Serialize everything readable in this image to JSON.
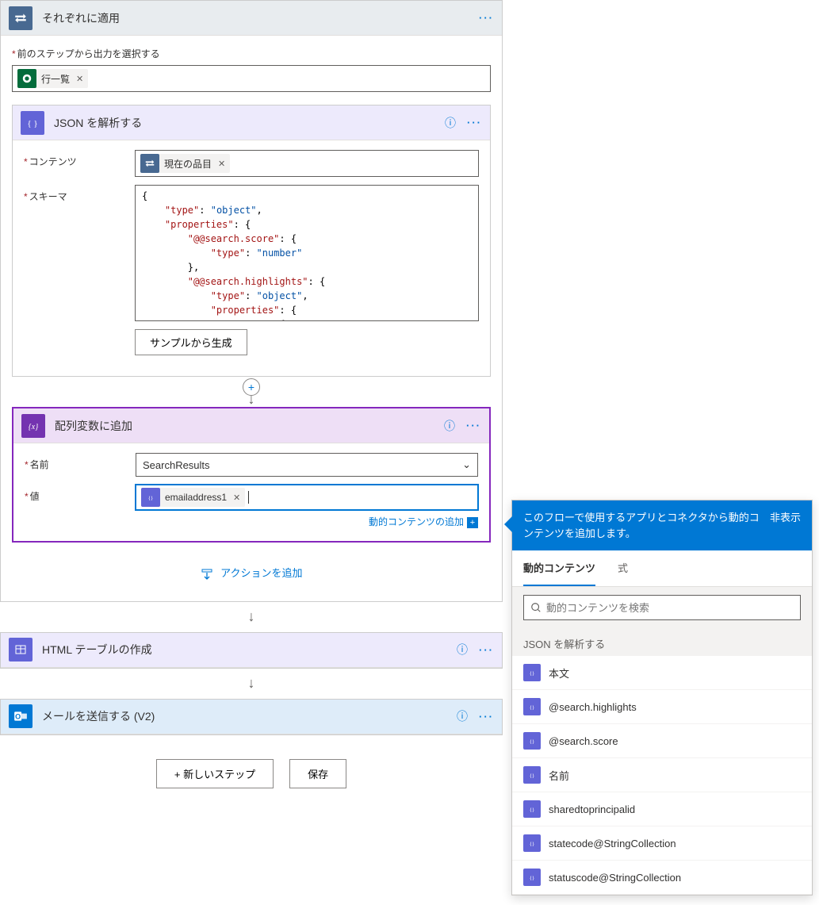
{
  "foreach": {
    "title": "それぞれに適用",
    "select_output_label": "前のステップから出力を選択する",
    "token_label": "行一覧"
  },
  "parseJson": {
    "title": "JSON を解析する",
    "content_label": "コンテンツ",
    "content_token": "現在の品目",
    "schema_label": "スキーマ",
    "sample_button": "サンプルから生成",
    "schema_lines": [
      [
        {
          "t": "p",
          "v": "{"
        }
      ],
      [
        {
          "t": "p",
          "v": "    "
        },
        {
          "t": "k",
          "v": "\"type\""
        },
        {
          "t": "p",
          "v": ": "
        },
        {
          "t": "v",
          "v": "\"object\""
        },
        {
          "t": "p",
          "v": ","
        }
      ],
      [
        {
          "t": "p",
          "v": "    "
        },
        {
          "t": "k",
          "v": "\"properties\""
        },
        {
          "t": "p",
          "v": ": {"
        }
      ],
      [
        {
          "t": "p",
          "v": "        "
        },
        {
          "t": "k",
          "v": "\"@@search.score\""
        },
        {
          "t": "p",
          "v": ": {"
        }
      ],
      [
        {
          "t": "p",
          "v": "            "
        },
        {
          "t": "k",
          "v": "\"type\""
        },
        {
          "t": "p",
          "v": ": "
        },
        {
          "t": "v",
          "v": "\"number\""
        }
      ],
      [
        {
          "t": "p",
          "v": "        },"
        }
      ],
      [
        {
          "t": "p",
          "v": "        "
        },
        {
          "t": "k",
          "v": "\"@@search.highlights\""
        },
        {
          "t": "p",
          "v": ": {"
        }
      ],
      [
        {
          "t": "p",
          "v": "            "
        },
        {
          "t": "k",
          "v": "\"type\""
        },
        {
          "t": "p",
          "v": ": "
        },
        {
          "t": "v",
          "v": "\"object\""
        },
        {
          "t": "p",
          "v": ","
        }
      ],
      [
        {
          "t": "p",
          "v": "            "
        },
        {
          "t": "k",
          "v": "\"properties\""
        },
        {
          "t": "p",
          "v": ": {"
        }
      ],
      [
        {
          "t": "p",
          "v": "                "
        },
        {
          "t": "k",
          "v": "\"name\""
        },
        {
          "t": "p",
          "v": ": {"
        }
      ]
    ]
  },
  "appendArray": {
    "title": "配列変数に追加",
    "name_label": "名前",
    "name_value": "SearchResults",
    "value_label": "値",
    "value_token": "emailaddress1",
    "add_dynamic": "動的コンテンツの追加"
  },
  "addAction": "アクションを追加",
  "htmlTable": {
    "title": "HTML テーブルの作成"
  },
  "sendMail": {
    "title": "メールを送信する (V2)"
  },
  "newStep": "+ 新しいステップ",
  "save": "保存",
  "dynamicPanel": {
    "header_text": "このフローで使用するアプリとコネクタから動的コンテンツを追加します。",
    "hide": "非表示",
    "tab_dynamic": "動的コンテンツ",
    "tab_expression": "式",
    "search_placeholder": "動的コンテンツを検索",
    "section_title": "JSON を解析する",
    "items": [
      "本文",
      "@search.highlights",
      "@search.score",
      "名前",
      "sharedtoprincipalid",
      "statecode@StringCollection",
      "statuscode@StringCollection"
    ]
  }
}
